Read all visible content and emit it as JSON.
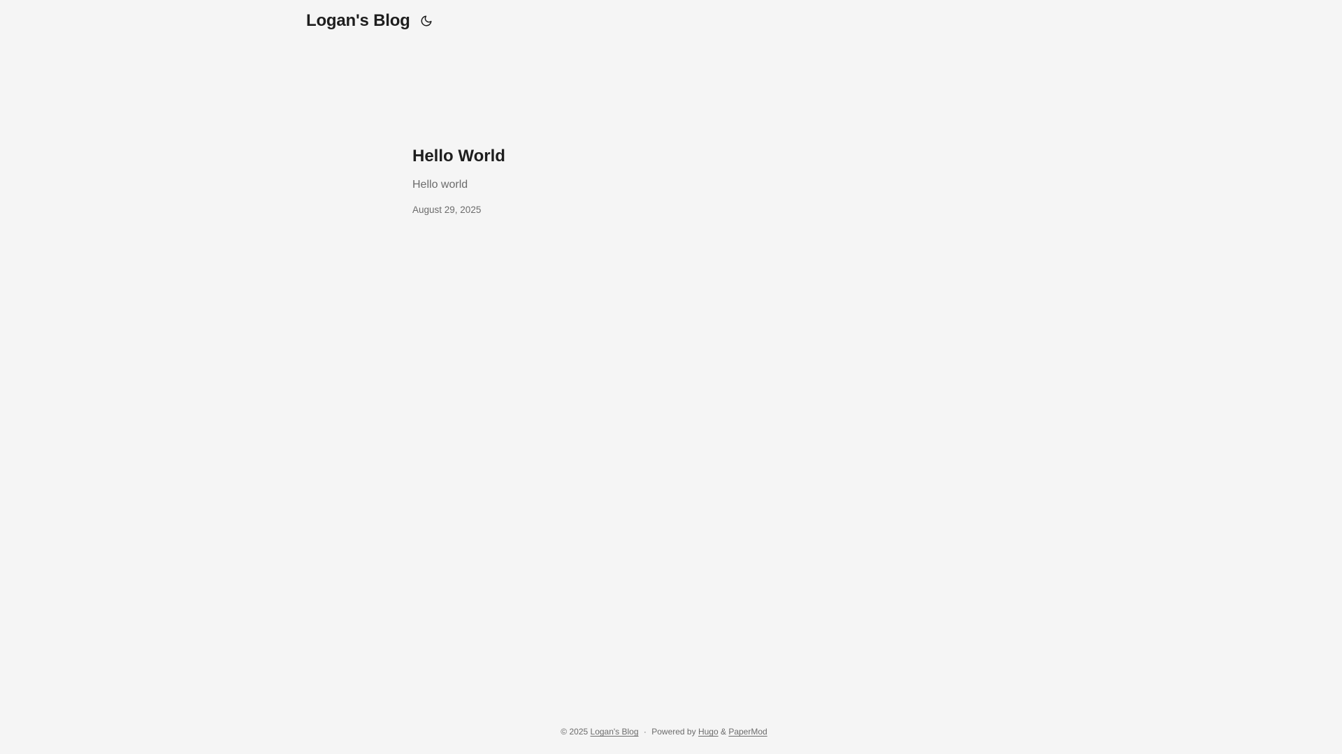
{
  "header": {
    "logo_text": "Logan's Blog",
    "theme_toggle_icon": "moon-icon"
  },
  "posts": [
    {
      "title": "Hello World",
      "summary": "Hello world",
      "date": "August 29, 2025"
    }
  ],
  "footer": {
    "copyright": "© 2025",
    "site_link": "Logan's Blog",
    "separator": "·",
    "powered_by": "Powered by",
    "hugo_link": "Hugo",
    "ampersand": "&",
    "papermod_link": "PaperMod"
  },
  "colors": {
    "background": "#f5f5f5",
    "primary_text": "#1e1e1e",
    "secondary_text": "#6b6b6b"
  }
}
